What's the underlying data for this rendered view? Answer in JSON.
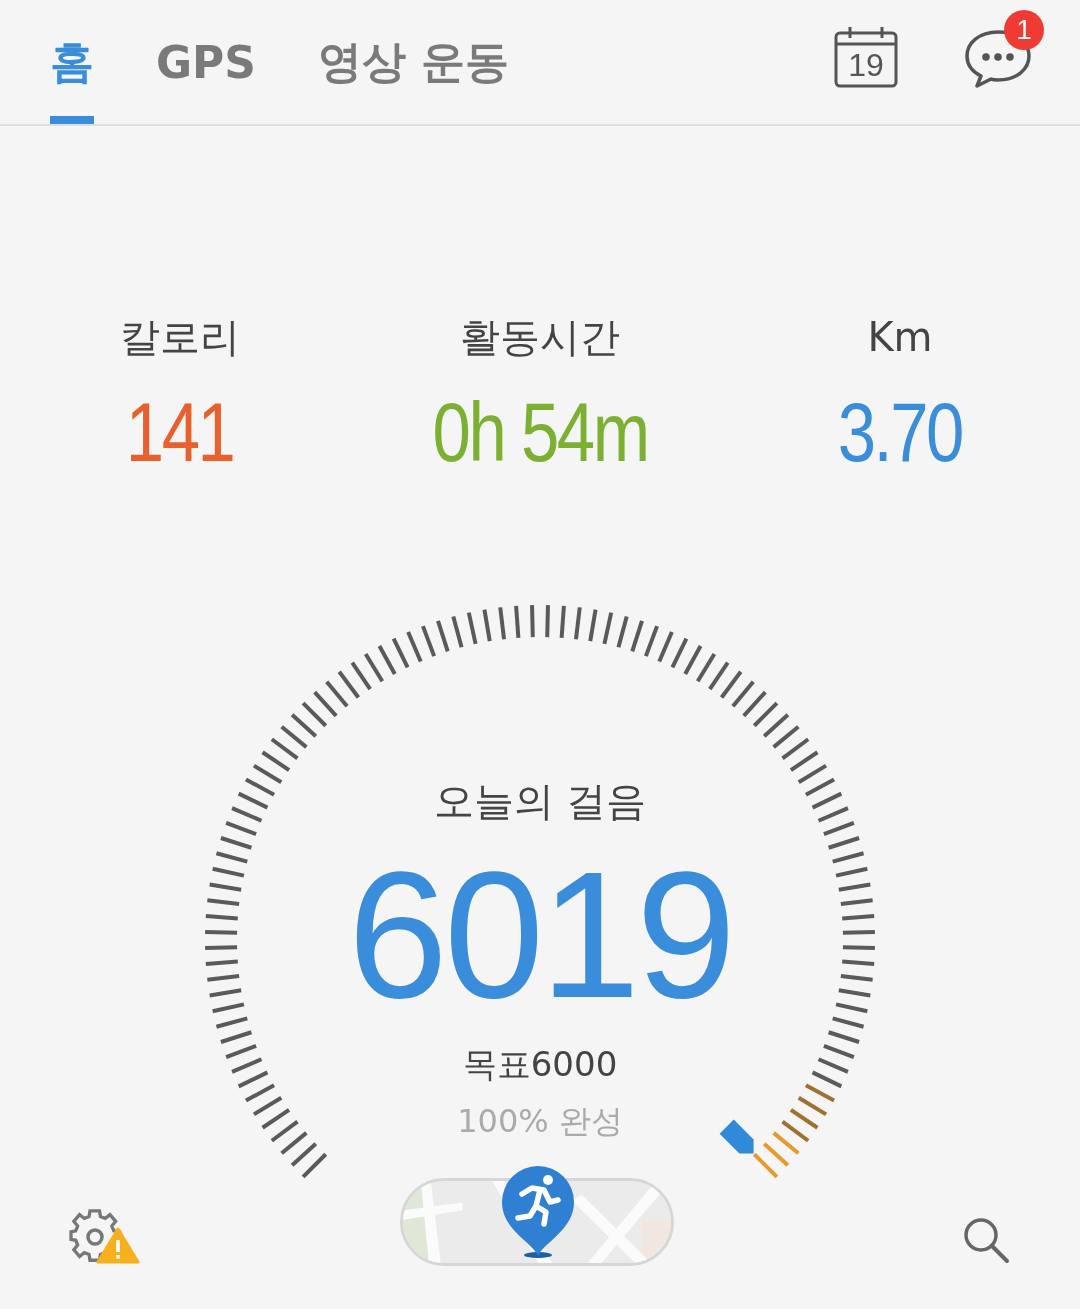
{
  "tabs": [
    {
      "label": "홈",
      "selected": true
    },
    {
      "label": "GPS",
      "selected": false
    },
    {
      "label": "영상 운동",
      "selected": false
    }
  ],
  "calendar": {
    "day": "19"
  },
  "messages": {
    "badge": "1"
  },
  "stats": [
    {
      "label": "칼로리",
      "value": "141",
      "color": "#e8612c"
    },
    {
      "label": "활동시간",
      "value": "0h 54m",
      "color": "#7cb032"
    },
    {
      "label": "Km",
      "value": "3.70",
      "color": "#3a8ddb"
    }
  ],
  "steps": {
    "title": "오늘의 걸음",
    "count": "6019",
    "goal": "목표6000",
    "progress": "100% 완성"
  }
}
